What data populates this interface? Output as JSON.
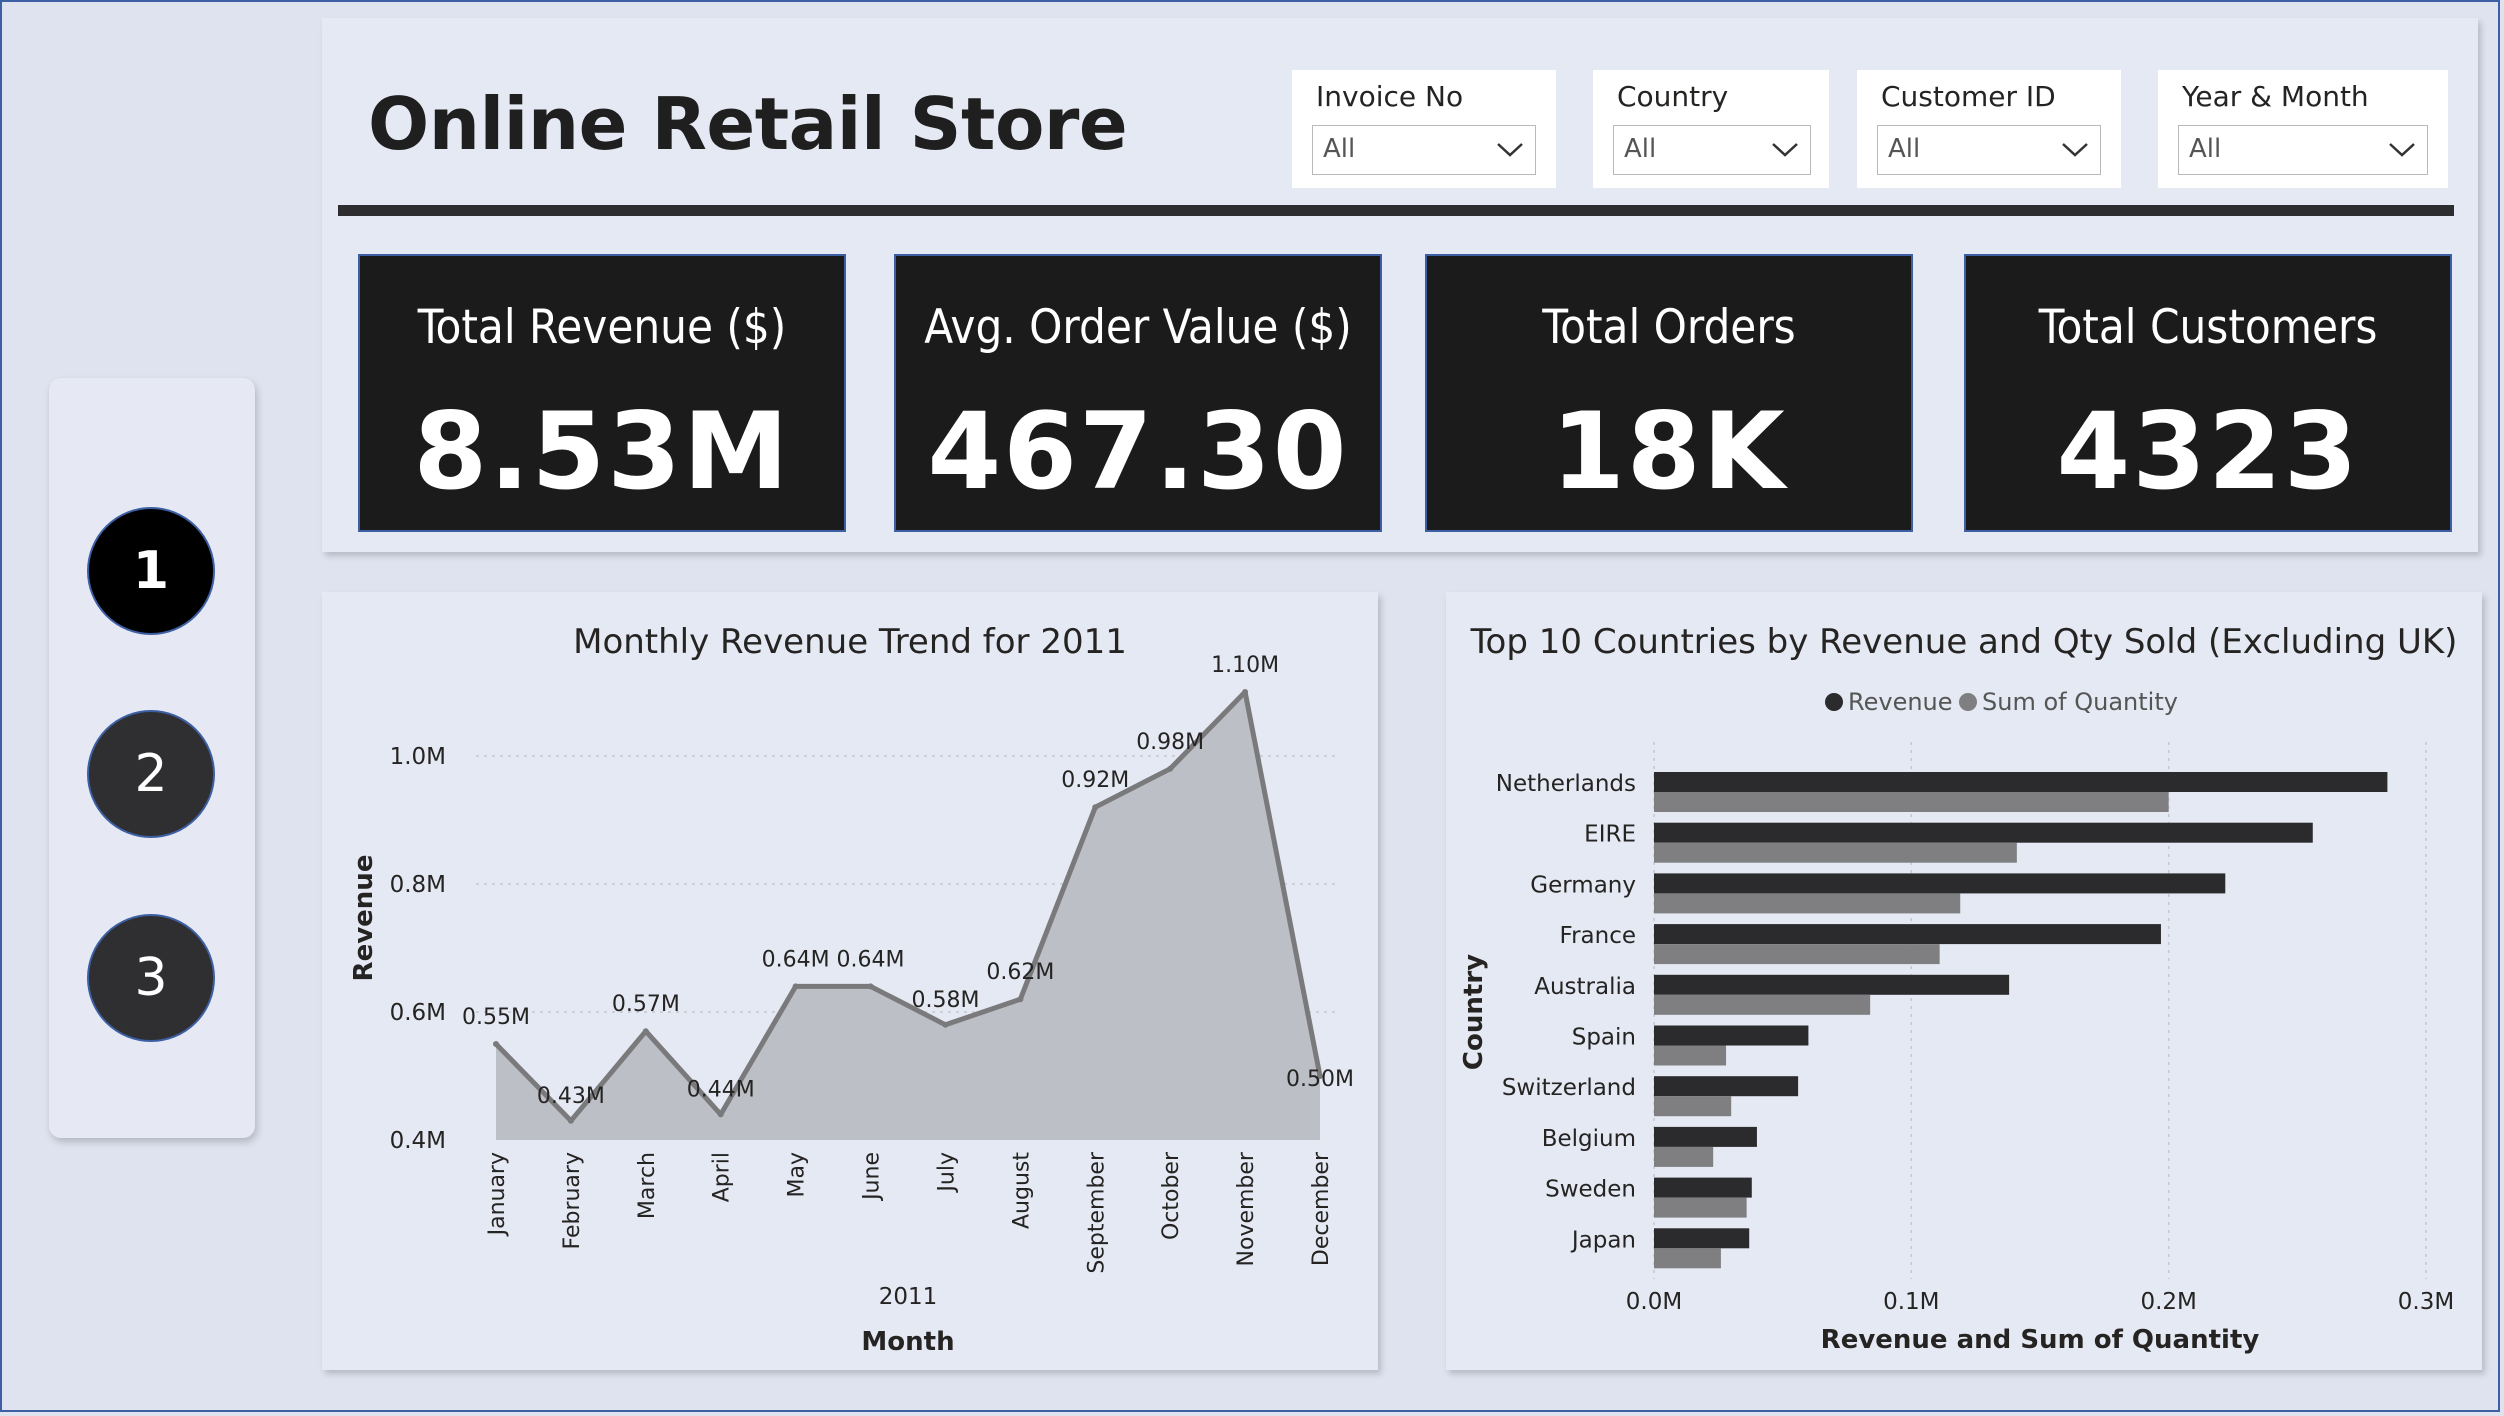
{
  "title": "Online Retail Store",
  "nav": {
    "buttons": [
      "1",
      "2",
      "3"
    ],
    "active": "1"
  },
  "slicers": [
    {
      "label": "Invoice No",
      "value": "All"
    },
    {
      "label": "Country",
      "value": "All"
    },
    {
      "label": "Customer ID",
      "value": "All"
    },
    {
      "label": "Year & Month",
      "value": "All"
    }
  ],
  "kpis": [
    {
      "label": "Total Revenue ($)",
      "value": "8.53M"
    },
    {
      "label": "Avg. Order Value ($)",
      "value": "467.30"
    },
    {
      "label": "Total Orders",
      "value": "18K"
    },
    {
      "label": "Total Customers",
      "value": "4323"
    }
  ],
  "colors": {
    "kpi_bg": "#1b1b1c",
    "area_fill": "#bdbfc6",
    "area_line": "#7a7a7c",
    "revenue_bar": "#2b2b2d",
    "quantity_bar": "#7f7f81",
    "accent_border": "#3d5fa3"
  },
  "chart_data": [
    {
      "type": "area",
      "title": "Monthly Revenue Trend for 2011",
      "xlabel": "Month",
      "x_group_label": "2011",
      "ylabel": "Revenue",
      "categories": [
        "January",
        "February",
        "March",
        "April",
        "May",
        "June",
        "July",
        "August",
        "September",
        "October",
        "November",
        "December"
      ],
      "values": [
        0.55,
        0.43,
        0.57,
        0.44,
        0.64,
        0.64,
        0.58,
        0.62,
        0.92,
        0.98,
        1.1,
        0.5
      ],
      "data_labels": [
        "0.55M",
        "0.43M",
        "0.57M",
        "0.44M",
        "0.64M",
        "0.64M",
        "0.58M",
        "0.62M",
        "0.92M",
        "0.98M",
        "1.10M",
        "0.50M"
      ],
      "ylim": [
        0.4,
        1.1
      ],
      "y_ticks": [
        0.4,
        0.6,
        0.8,
        1.0
      ],
      "y_tick_labels": [
        "0.4M",
        "0.6M",
        "0.8M",
        "1.0M"
      ],
      "grid": true
    },
    {
      "type": "bar",
      "orientation": "horizontal",
      "title": "Top 10 Countries by Revenue and Qty Sold (Excluding UK)",
      "xlabel": "Revenue and Sum of Quantity",
      "ylabel": "Country",
      "categories": [
        "Netherlands",
        "EIRE",
        "Germany",
        "France",
        "Australia",
        "Spain",
        "Switzerland",
        "Belgium",
        "Sweden",
        "Japan"
      ],
      "series": [
        {
          "name": "Revenue",
          "values": [
            0.285,
            0.256,
            0.222,
            0.197,
            0.138,
            0.06,
            0.056,
            0.04,
            0.038,
            0.037
          ]
        },
        {
          "name": "Sum of Quantity",
          "values": [
            0.2,
            0.141,
            0.119,
            0.111,
            0.084,
            0.028,
            0.03,
            0.023,
            0.036,
            0.026
          ]
        }
      ],
      "xlim": [
        0,
        0.3
      ],
      "x_ticks": [
        0,
        0.1,
        0.2,
        0.3
      ],
      "x_tick_labels": [
        "0.0M",
        "0.1M",
        "0.2M",
        "0.3M"
      ],
      "legend_position": "top-center",
      "grid": true
    }
  ]
}
